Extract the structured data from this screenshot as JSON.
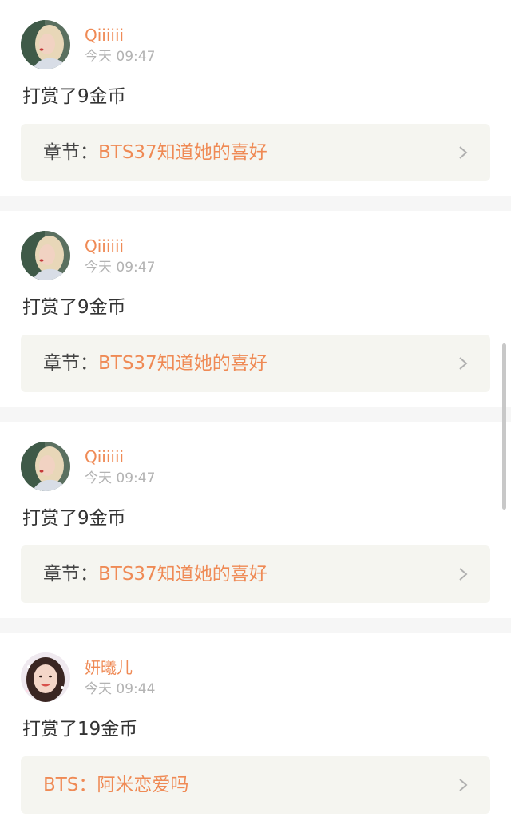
{
  "colors": {
    "accent": "#ef8a55",
    "text": "#333333",
    "muted": "#b3b3b3",
    "chapter_bg": "#f5f5f0",
    "separator": "#f6f6f6"
  },
  "items": [
    {
      "username": "Qiiiiii",
      "time": "今天 09:47",
      "action": "打赏了9金币",
      "chapter_prefix": "章节：",
      "chapter_title": "BTS37知道她的喜好",
      "avatar_icon": "blonde-woman-avatar",
      "chevron_icon": "chevron-right-icon"
    },
    {
      "username": "Qiiiiii",
      "time": "今天 09:47",
      "action": "打赏了9金币",
      "chapter_prefix": "章节：",
      "chapter_title": "BTS37知道她的喜好",
      "avatar_icon": "blonde-woman-avatar",
      "chevron_icon": "chevron-right-icon"
    },
    {
      "username": "Qiiiiii",
      "time": "今天 09:47",
      "action": "打赏了9金币",
      "chapter_prefix": "章节：",
      "chapter_title": "BTS37知道她的喜好",
      "avatar_icon": "blonde-woman-avatar",
      "chevron_icon": "chevron-right-icon"
    },
    {
      "username": "妍曦儿",
      "time": "今天 09:44",
      "action": "打赏了19金币",
      "chapter_prefix": "",
      "chapter_title": "BTS：阿米恋爱吗",
      "avatar_icon": "smiling-girl-avatar",
      "chevron_icon": "chevron-right-icon"
    }
  ]
}
